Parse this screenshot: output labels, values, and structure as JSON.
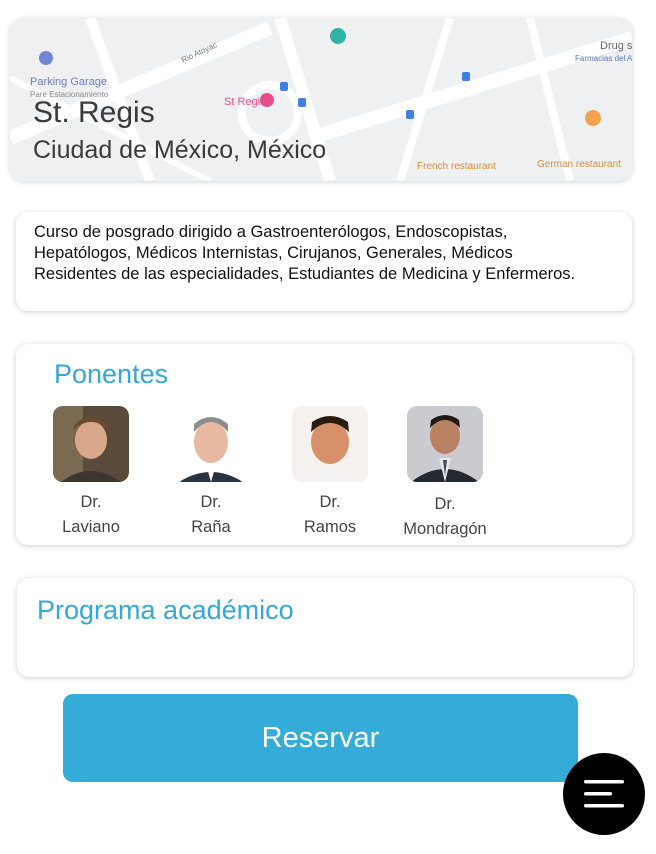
{
  "location": {
    "name": "St. Regis",
    "city": "Ciudad de México, México",
    "map_labels": {
      "parking_garage": "Parking Garage",
      "parking_sub": "Pare Estacionamiento",
      "street": "Rio Atoyac",
      "st_regis": "St Regis",
      "drug_store": "Drug st",
      "pharmacy": "Farmacias del Ah",
      "french_restaurant": "French restaurant",
      "german_restaurant": "German restaurant"
    }
  },
  "description": "Curso de posgrado dirigido a Gastroenterólogos, Endoscopistas, Hepatólogos, Médicos Internistas, Cirujanos, Generales, Médicos Residentes de las especialidades, Estudiantes de Medicina y Enfermeros.",
  "speakers": {
    "title": "Ponentes",
    "items": [
      {
        "title": "Dr.",
        "name": "Laviano"
      },
      {
        "title": "Dr.",
        "name": "Raña"
      },
      {
        "title": "Dr.",
        "name": "Ramos"
      },
      {
        "title": "Dr.",
        "name": "Mondragón"
      }
    ]
  },
  "program": {
    "title": "Programa académico"
  },
  "reserve_label": "Reservar",
  "colors": {
    "accent": "#35acd8",
    "title": "#34a8d6",
    "fab": "#000000"
  },
  "icons": {
    "menu": "hamburger-menu-icon"
  }
}
